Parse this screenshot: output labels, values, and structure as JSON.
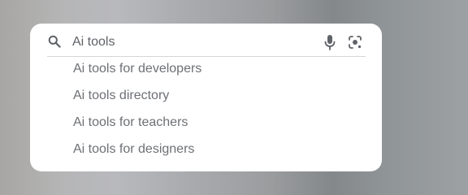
{
  "search": {
    "value": "Ai tools",
    "icons": {
      "search": "search-icon",
      "voice": "mic-icon",
      "image": "lens-icon"
    }
  },
  "suggestions": [
    {
      "label": "Ai tools for developers"
    },
    {
      "label": "Ai tools directory"
    },
    {
      "label": "Ai tools for teachers"
    },
    {
      "label": "Ai tools for designers"
    }
  ],
  "colors": {
    "card_background": "#ffffff",
    "text": "#5f6368",
    "suggestion_text": "#6d7075",
    "divider": "#d3d5d8",
    "icon": "#5f6368"
  }
}
